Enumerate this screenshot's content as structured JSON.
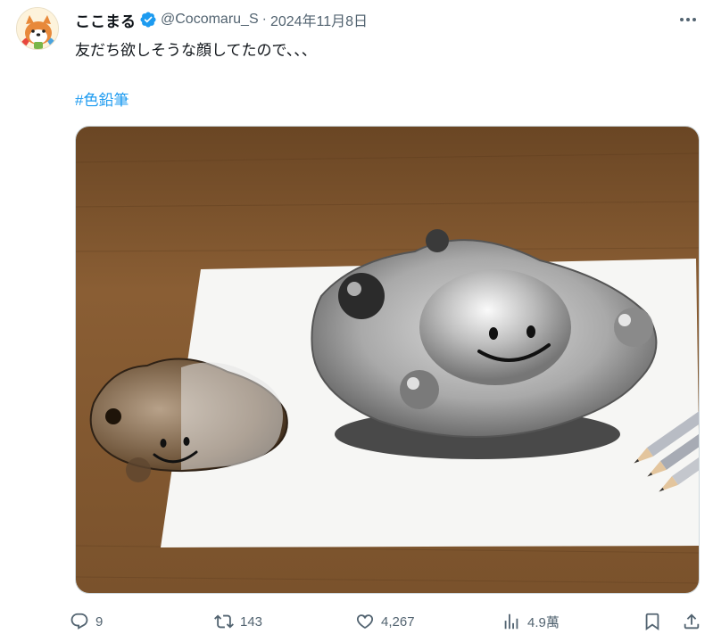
{
  "tweet": {
    "display_name": "ここまる",
    "handle": "@Cocomaru_S",
    "separator": "·",
    "date": "2024年11月8日",
    "text": "友だち欲しそうな顔してたので、、、",
    "hashtag": "#色鉛筆"
  },
  "actions": {
    "replies": "9",
    "reposts": "143",
    "likes": "4,267",
    "views": "4.9萬"
  },
  "icons": {
    "verified": "verified-badge-icon",
    "more": "more-icon",
    "reply": "reply-icon",
    "repost": "repost-icon",
    "like": "heart-icon",
    "views": "views-chart-icon",
    "bookmark": "bookmark-icon",
    "share": "share-icon"
  },
  "colors": {
    "text": "#0f1419",
    "secondary": "#536471",
    "link": "#1d9bf0",
    "verified": "#1d9bf0"
  }
}
